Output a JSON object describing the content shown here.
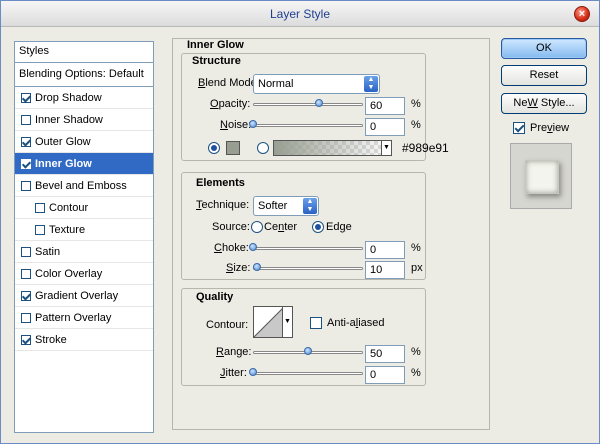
{
  "window": {
    "title": "Layer Style",
    "close_glyph": "×"
  },
  "styles": {
    "header": "Styles",
    "blending": "Blending Options: Default",
    "items": [
      {
        "label": "Drop Shadow",
        "checked": true
      },
      {
        "label": "Inner Shadow",
        "checked": false
      },
      {
        "label": "Outer Glow",
        "checked": true
      },
      {
        "label": "Inner Glow",
        "checked": true,
        "selected": true
      },
      {
        "label": "Bevel and Emboss",
        "checked": false
      },
      {
        "label": "Contour",
        "checked": false,
        "sub": true
      },
      {
        "label": "Texture",
        "checked": false,
        "sub": true
      },
      {
        "label": "Satin",
        "checked": false
      },
      {
        "label": "Color Overlay",
        "checked": false
      },
      {
        "label": "Gradient Overlay",
        "checked": true
      },
      {
        "label": "Pattern Overlay",
        "checked": false
      },
      {
        "label": "Stroke",
        "checked": true
      }
    ]
  },
  "panel": {
    "title": "Inner Glow",
    "structure": {
      "heading": "Structure",
      "blend_mode_label_u": "B",
      "blend_mode_label_rest": "lend Mode:",
      "blend_mode": "Normal",
      "opacity_label_u": "O",
      "opacity_label_rest": "pacity:",
      "opacity": "60",
      "opacity_level": 0.6,
      "noise_label_u": "N",
      "noise_label_rest": "oise:",
      "noise": "0",
      "noise_level": 0.0,
      "unit": "%",
      "color_hex": "#989e91",
      "swatch_color": "#989e91"
    },
    "elements": {
      "heading": "Elements",
      "technique_label_u": "T",
      "technique_label_rest": "echnique:",
      "technique": "Softer",
      "source_label": "Source:",
      "center_u": "n",
      "center_pre": "Ce",
      "center_post": "ter",
      "edge_u": "g",
      "edge_pre": "Ed",
      "edge_post": "e",
      "choke_label_u": "C",
      "choke_label_rest": "hoke:",
      "choke": "0",
      "choke_unit": "%",
      "choke_level": 0.0,
      "size_label_u": "S",
      "size_label_rest": "ize:",
      "size": "10",
      "size_unit": "px",
      "size_level": 0.04
    },
    "quality": {
      "heading": "Quality",
      "contour_label": "Contour:",
      "antialiased_pre": "Anti-a",
      "antialiased_u": "l",
      "antialiased_post": "iased",
      "range_label_u": "R",
      "range_label_rest": "ange:",
      "range": "50",
      "range_unit": "%",
      "range_level": 0.5,
      "jitter_label_u": "J",
      "jitter_label_rest": "itter:",
      "jitter": "0",
      "jitter_unit": "%",
      "jitter_level": 0.0
    }
  },
  "buttons": {
    "ok": "OK",
    "reset": "Reset",
    "new_style_u": "W",
    "new_style_pre": "Ne",
    "new_style_post": " Style...",
    "preview_u": "v",
    "preview_pre": "Pre",
    "preview_post": "iew",
    "preview_checked": true
  }
}
